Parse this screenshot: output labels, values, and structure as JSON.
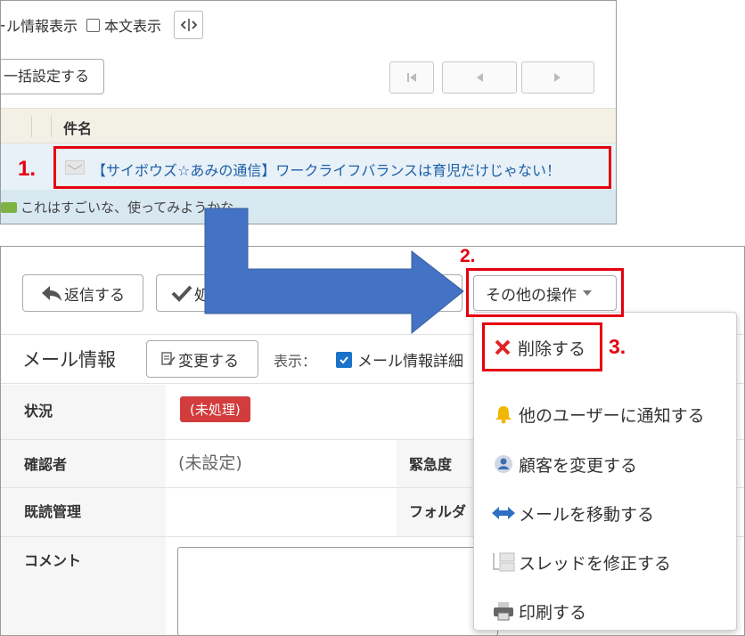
{
  "top": {
    "mail_info_label": "ール情報表示",
    "body_label": "本文表示",
    "bulk_button": "一括設定する",
    "column_subject": "件名",
    "mail_subject": "【サイボウズ☆あみの通信】ワークライフバランスは育児だけじゃない！",
    "mail_preview": "これはすごいな、使ってみようかな。"
  },
  "steps": {
    "s1": "1.",
    "s2": "2.",
    "s3": "3."
  },
  "toolbar": {
    "reply": "返信する",
    "done_partial": "処",
    "other_ops": "その他の操作"
  },
  "info": {
    "title": "メール情報",
    "change": "変更する",
    "display_label": "表示：",
    "detail_label": "メール情報詳細"
  },
  "fields": {
    "status": "状況",
    "status_value": "(未処理)",
    "confirmer": "確認者",
    "confirmer_value": "(未設定)",
    "urgency": "緊急度",
    "read_mgmt": "既読管理",
    "folder": "フォルダ",
    "comment": "コメント"
  },
  "menu": {
    "delete": "削除する",
    "notify": "他のユーザーに通知する",
    "change_customer": "顧客を変更する",
    "move": "メールを移動する",
    "thread": "スレッドを修正する",
    "print": "印刷する"
  },
  "colors": {
    "highlight": "#e5000f",
    "link": "#1c5fa8",
    "arrow": "#4472c4",
    "badge": "#d23c3c"
  },
  "icons": [
    "toggle-split-icon",
    "first-page-icon",
    "prev-page-icon",
    "next-page-icon",
    "envelope-icon",
    "comment-icon",
    "reply-icon",
    "check-icon",
    "caret-down-icon",
    "edit-doc-icon",
    "x-icon",
    "bell-icon",
    "user-icon",
    "move-arrows-icon",
    "thread-icon",
    "printer-icon"
  ]
}
